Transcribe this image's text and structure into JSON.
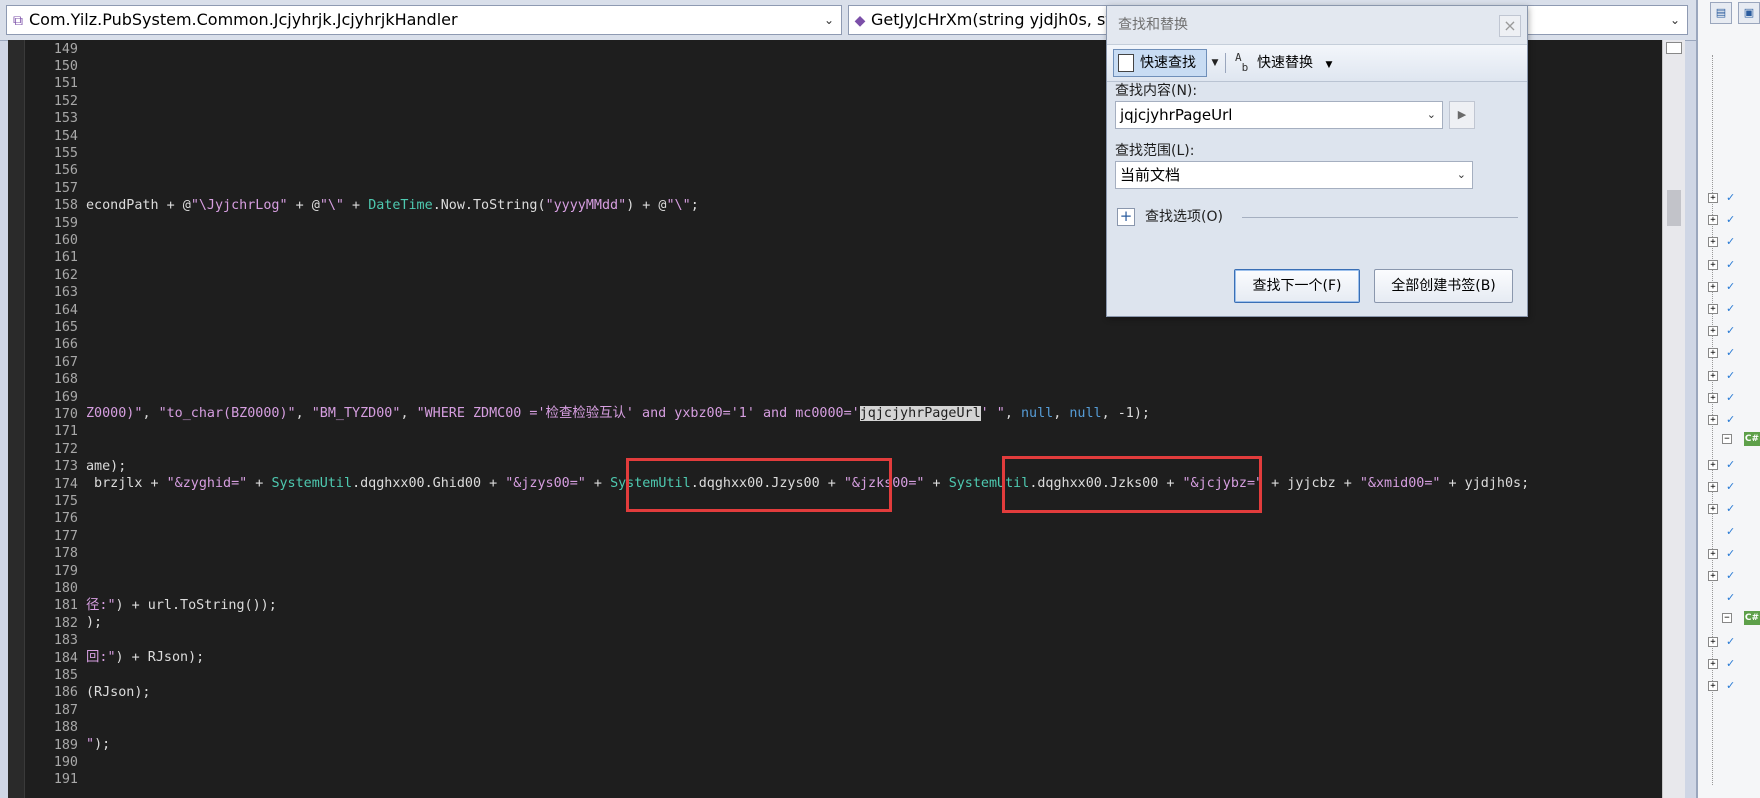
{
  "navbar": {
    "class_combo": "Com.Yilz.PubSystem.Common.Jcjyhrjk.JcjyhrjkHandler",
    "method_combo": "GetJyJcHrXm(string yjdjh0s, string"
  },
  "editor": {
    "line_numbers": [
      "149",
      "150",
      "151",
      "152",
      "153",
      "154",
      "155",
      "156",
      "157",
      "158",
      "159",
      "160",
      "161",
      "162",
      "163",
      "164",
      "165",
      "166",
      "167",
      "168",
      "169",
      "170",
      "171",
      "172",
      "173",
      "174",
      "175",
      "176",
      "177",
      "178",
      "179",
      "180",
      "181",
      "182",
      "183",
      "184",
      "185",
      "186",
      "187",
      "188",
      "189",
      "190",
      "191"
    ],
    "code": {
      "l158": {
        "p1": "econdPath + @",
        "s1": "\"\\JyjchrLog\"",
        "p2": " + @",
        "s2": "\"\\\"",
        "p3": " + ",
        "t1": "DateTime",
        "p4": ".Now.ToString(",
        "s3": "\"yyyyMMdd\"",
        "p5": ") + @",
        "s4": "\"\\\"",
        "p6": ";"
      },
      "l170": {
        "s1": "Z0000)\"",
        "p1": ", ",
        "s2": "\"to_char(BZ0000)\"",
        "p2": ", ",
        "s3": "\"BM_TYZD00\"",
        "p3": ", ",
        "s4": "\"WHERE ZDMC00 ='检查检验互认' and yxbz00='1' and mc0000='",
        "hl": "jqjcjyhrPageUrl",
        "s5": "' \"",
        "p4": ", ",
        "k1": "null",
        "p5": ", ",
        "k2": "null",
        "p6": ", -1);"
      },
      "l173": "ame);",
      "l174": {
        "p1": " brzjlx + ",
        "s1": "\"&zyghid=\"",
        "p2": " + ",
        "t1": "SystemUtil",
        "p3": ".dqghxx00.Ghid00 + ",
        "s2": "\"&jzys00=\"",
        "p4": " + ",
        "t2": "SystemUtil",
        "p5": ".dqghxx00.Jzys00 + ",
        "s3": "\"&jzks00=\"",
        "p6": " + ",
        "t3": "SystemUtil",
        "p7": ".dqghxx00.Jzks00 + ",
        "s4": "\"&jcjybz=\"",
        "p8": " + jyjcbz + ",
        "s5": "\"&xmid00=\"",
        "p9": " + yjdjh0s;"
      },
      "l181": {
        "s1": "径:\"",
        "p1": ") + url.ToString());"
      },
      "l182": ");",
      "l184": {
        "s1": "回:\"",
        "p1": ") + RJson);"
      },
      "l186": "(RJson);",
      "l189": {
        "s1": "\"",
        "p1": ");"
      }
    }
  },
  "find_dialog": {
    "title": "查找和替换",
    "close": "×",
    "quick_find": "快速查找",
    "quick_replace": "快速替换",
    "find_label": "查找内容(N):",
    "find_value": "jqjcjyhrPageUrl",
    "scope_label": "查找范围(L):",
    "scope_value": "当前文档",
    "options_label": "查找选项(O)",
    "find_next": "查找下一个(F)",
    "bookmark_all": "全部创建书签(B)"
  },
  "colors": {
    "string": "#d69ee0",
    "type": "#4ec9b0",
    "keyword": "#569cd6",
    "highlight_box": "#e23c3c"
  },
  "icons": {
    "class": "class-icon",
    "method": "method-icon",
    "quick_find": "find-icon",
    "quick_replace": "replace-icon",
    "expand": "plus-icon"
  }
}
